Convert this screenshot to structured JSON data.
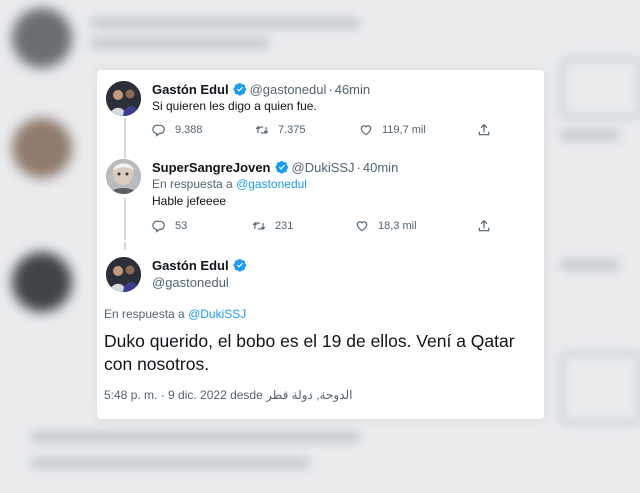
{
  "tweets": [
    {
      "name": "Gastón Edul",
      "handle": "@gastonedul",
      "separator": "·",
      "time": "46min",
      "text": "Si quieren les digo a quien fue.",
      "stats": {
        "replies": "9.388",
        "retweets": "7.375",
        "likes": "119,7 mil"
      }
    },
    {
      "name": "SuperSangreJoven",
      "handle": "@DukiSSJ",
      "separator": "·",
      "time": "40min",
      "reply_prefix": "En respuesta a",
      "reply_to": "@gastonedul",
      "text": "Hable jefeeee",
      "stats": {
        "replies": "53",
        "retweets": "231",
        "likes": "18,3 mil"
      }
    }
  ],
  "main_tweet": {
    "name": "Gastón Edul",
    "handle": "@gastonedul",
    "reply_prefix": "En respuesta a",
    "reply_to": "@DukiSSJ",
    "text": "Duko querido, el bobo es el 19 de ellos. Vení a Qatar con nosotros.",
    "meta": "5:48 p. m. · 9 dic. 2022 desde الدوحة, دولة قطر"
  },
  "colors": {
    "accent": "#1d9bf0",
    "text": "#0f1419",
    "muted": "#536471"
  }
}
